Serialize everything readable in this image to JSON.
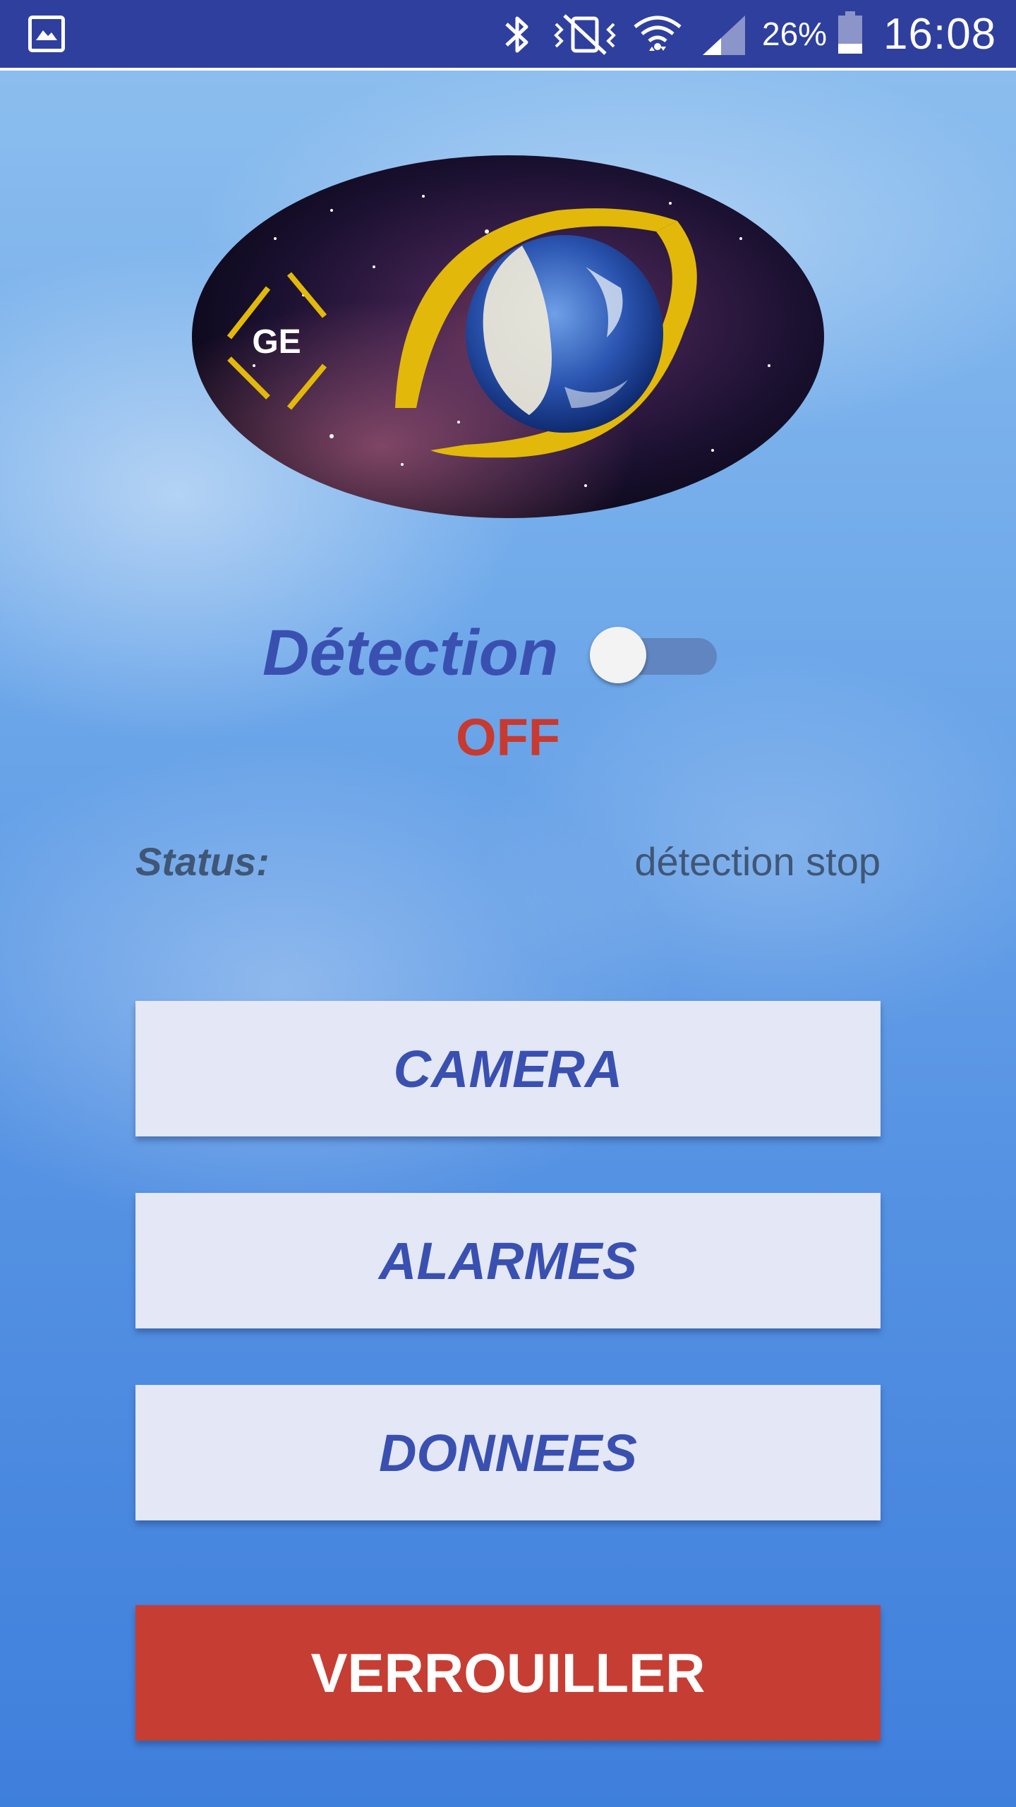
{
  "status_bar": {
    "battery_percent": "26%",
    "battery_level": 0.26,
    "time": "16:08",
    "icons": [
      "gallery-icon",
      "bluetooth-icon",
      "vibrate-icon",
      "wifi-icon",
      "signal-icon",
      "battery-icon"
    ]
  },
  "logo": {
    "text": "GE"
  },
  "detection": {
    "label": "Détection",
    "state": "OFF",
    "enabled": false
  },
  "status": {
    "label": "Status:",
    "value": "détection stop"
  },
  "buttons": {
    "camera": "CAMERA",
    "alarmes": "ALARMES",
    "donnees": "DONNEES",
    "verrouiller": "VERROUILLER"
  },
  "colors": {
    "status_bar": "#2f3f9e",
    "accent_blue": "#3a50b0",
    "off_red": "#c8392f",
    "lock_button": "#c63e33",
    "button_bg": "#e3e7f6"
  }
}
